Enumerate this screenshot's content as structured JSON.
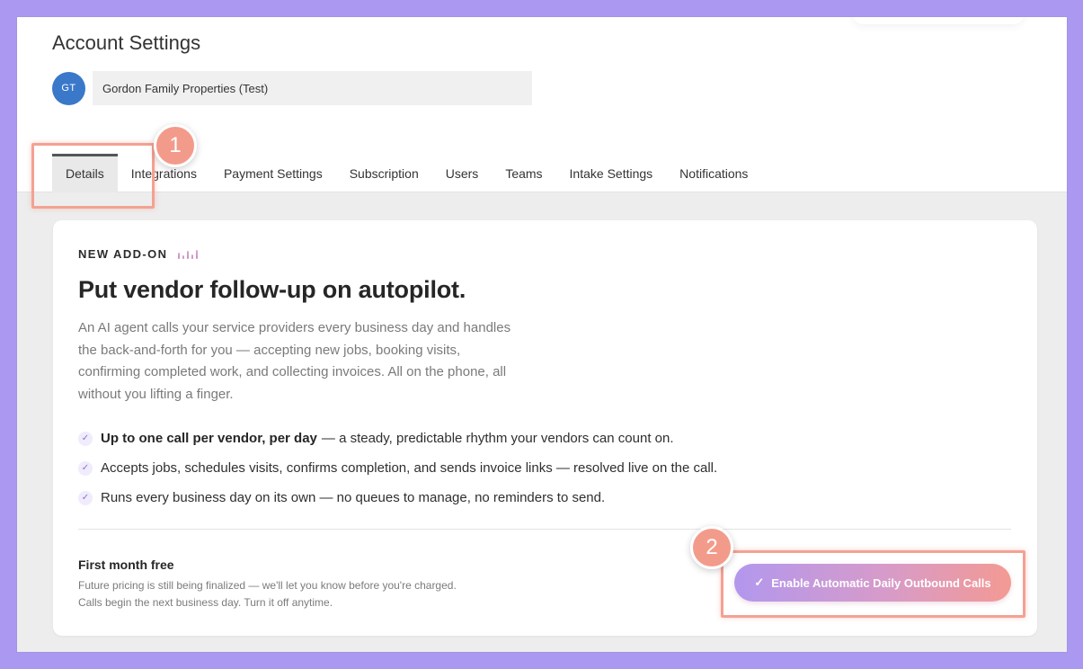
{
  "header": {
    "title": "Account Settings",
    "account": {
      "initials": "GT",
      "name": "Gordon Family Properties (Test)"
    }
  },
  "tabs": [
    {
      "label": "Details",
      "active": true
    },
    {
      "label": "Integrations"
    },
    {
      "label": "Payment Settings"
    },
    {
      "label": "Subscription"
    },
    {
      "label": "Users"
    },
    {
      "label": "Teams"
    },
    {
      "label": "Intake Settings"
    },
    {
      "label": "Notifications"
    }
  ],
  "addon": {
    "eyebrow": "NEW ADD-ON",
    "headline": "Put vendor follow-up on autopilot.",
    "description": "An AI agent calls your service providers every business day and handles the back-and-forth for you — accepting new jobs, booking visits, confirming completed work, and collecting invoices. All on the phone, all without you lifting a finger.",
    "features": [
      {
        "bold": "Up to one call per vendor, per day",
        "text": "— a steady, predictable rhythm your vendors can count on."
      },
      {
        "bold": "",
        "text": "Accepts jobs, schedules visits, confirms completion, and sends invoice links — resolved live on the call."
      },
      {
        "bold": "",
        "text": "Runs every business day on its own — no queues to manage, no reminders to send."
      }
    ],
    "offer_title": "First month free",
    "offer_note_1": "Future pricing is still being finalized — we'll let you know before you're charged.",
    "offer_note_2": "Calls begin the next business day. Turn it off anytime.",
    "button_label": "Enable Automatic Daily Outbound Calls"
  },
  "annotations": {
    "marker_1": "1",
    "marker_2": "2"
  },
  "colors": {
    "background": "#ab99f1",
    "avatar": "#3a78c9",
    "highlight": "#f4a193",
    "button_gradient_start": "#b297ee",
    "button_gradient_end": "#f39a93"
  },
  "icons": {
    "feature_check": "checkmark-icon",
    "button_check": "checkmark-icon",
    "eyebrow_bars": "signal-bars-icon"
  }
}
